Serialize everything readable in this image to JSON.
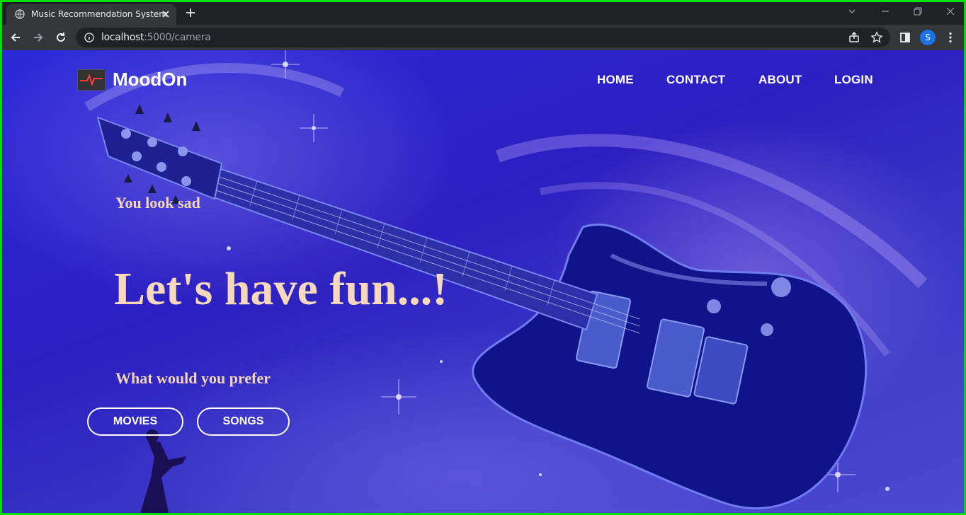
{
  "browser": {
    "tab_title": "Music Recommendation System",
    "url_host": "localhost",
    "url_rest": ":5000/camera",
    "profile_initial": "S"
  },
  "nav": {
    "brand": "MoodOn",
    "links": [
      "HOME",
      "CONTACT",
      "ABOUT",
      "LOGIN"
    ]
  },
  "hero": {
    "mood_text": "You look sad",
    "headline": "Let's have fun...!",
    "question": "What would you prefer",
    "buttons": [
      "MOVIES",
      "SONGS"
    ]
  },
  "colors": {
    "accent_text": "#f6d9bd",
    "page_background": "#2c1fc0"
  }
}
